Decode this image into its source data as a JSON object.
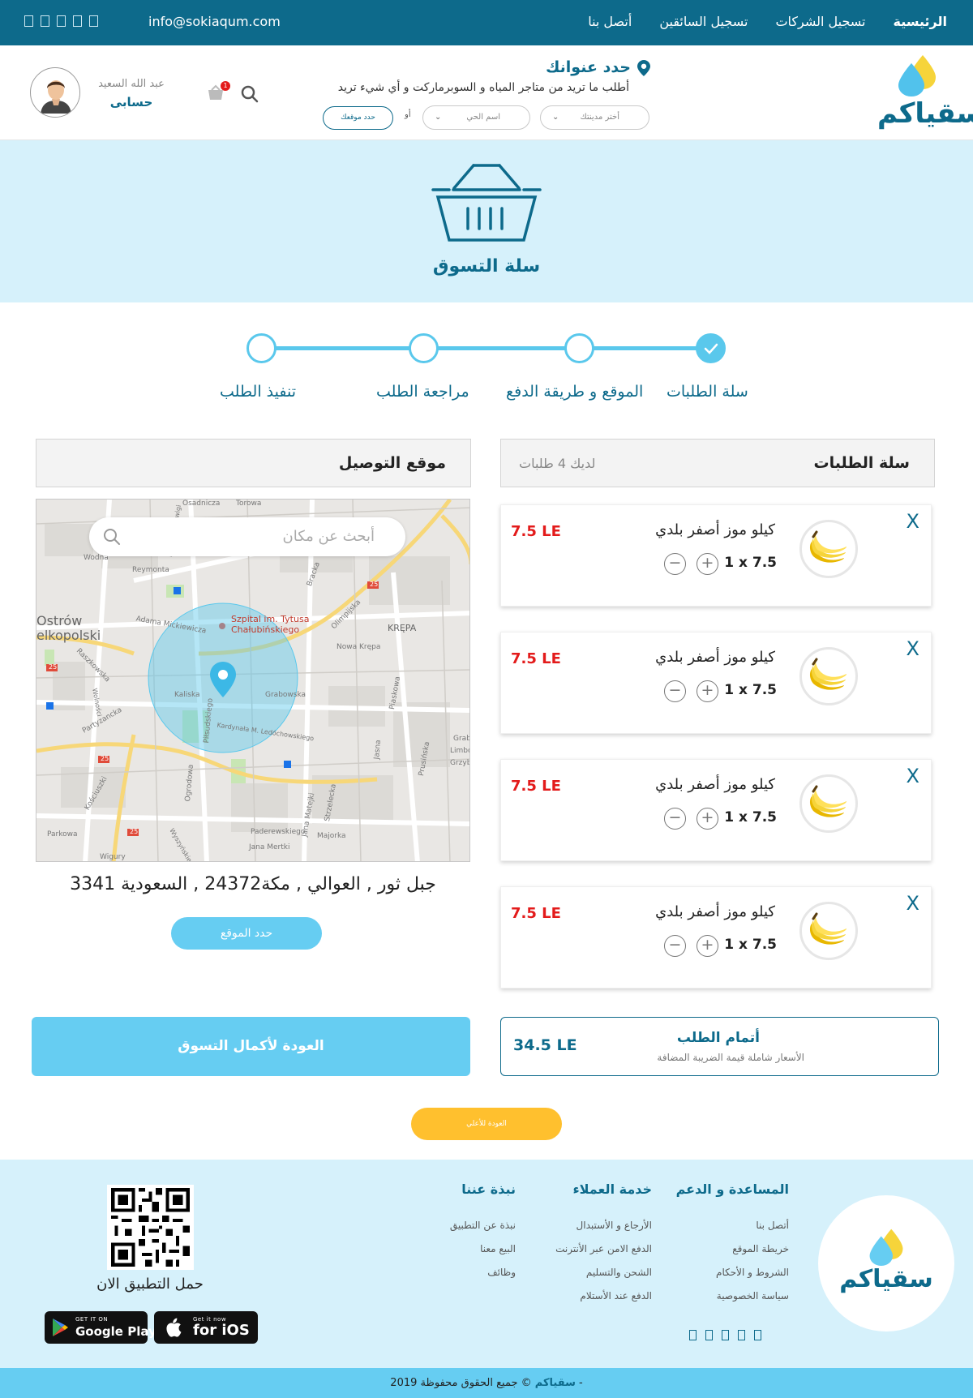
{
  "topbar": {
    "email": "info@sokiaqum.com",
    "nav": [
      "الرئيسية",
      "تسجيل الشركات",
      "تسجيل السائقين",
      "أتصل بنا"
    ],
    "social_icons": [
      "facebook-icon",
      "twitter-icon",
      "instagram-icon",
      "youtube-icon",
      "linkedin-icon"
    ]
  },
  "header": {
    "logo_text": "سقياكم",
    "address_title": "حدد عنوانك",
    "address_subtitle": "أطلب ما تريد من متاجر المياه و السوبرماركت و أي شيء تريد",
    "city_select": "أختر مدينتك",
    "district_select": "اسم الحي",
    "or_label": "أو",
    "locate_button": "حدد موقعك",
    "cart_badge": "1",
    "user_name": "عبد الله السعيد",
    "account_label": "حسابى"
  },
  "hero": {
    "title": "سلة التسوق"
  },
  "steps": [
    {
      "label": "سلة الطلبات",
      "done": true
    },
    {
      "label": "الموقع و طريقة الدفع",
      "done": false
    },
    {
      "label": "مراجعة الطلب",
      "done": false
    },
    {
      "label": "تنفيذ الطلب",
      "done": false
    }
  ],
  "cart": {
    "title": "سلة الطلبات",
    "count_text": "لديك 4 طلبات",
    "items": [
      {
        "name": "كيلو موز أصفر بلدي",
        "qty": "1 x 7.5",
        "price": "7.5 LE",
        "remove": "X"
      },
      {
        "name": "كيلو موز أصفر بلدي",
        "qty": "1 x 7.5",
        "price": "7.5 LE",
        "remove": "X"
      },
      {
        "name": "كيلو موز أصفر بلدي",
        "qty": "1 x 7.5",
        "price": "7.5 LE",
        "remove": "X"
      },
      {
        "name": "كيلو موز أصفر بلدي",
        "qty": "1 x 7.5",
        "price": "7.5 LE",
        "remove": "X"
      }
    ]
  },
  "delivery": {
    "title": "موقع التوصيل",
    "search_placeholder": "أبحث عن مكان",
    "address": "جبل ثور , العوالي , مكة24372 , السعودية 3341",
    "set_location_button": "حدد الموقع",
    "map_labels": {
      "osadnicza": "Osadnicza",
      "torowa": "Torowa",
      "wodna": "Wodna",
      "reymonta": "Reymonta",
      "krolowej_jadwigi": "Królowej Jadwigi",
      "ostrow": "Ostrów",
      "wielkopolski": "elkopolski",
      "adama": "Adama Mickiewicza",
      "szpital1": "Szpital im. Tytusa",
      "szpital2": "Chałubińskiego",
      "krepa": "KRĘPA",
      "olimpijska": "Olimpijska",
      "nowa_krepa": "Nowa Krępa",
      "raszkowska": "Raszkowska",
      "kaliska": "Kaliska",
      "grabowska": "Grabowska",
      "piaskowa": "Piaskowa",
      "partyzancka": "Partyzancka",
      "pilsudskiego": "Piłsudskiego",
      "kardynala": "Kardynała M. Ledóchowskiego",
      "jasna": "Jasna",
      "prusinska": "Prusińska",
      "kosciuszki": "Kościuszki",
      "matejki": "Jana Matejki",
      "strzelecka": "Strzelecka",
      "parkowa": "Parkowa",
      "wyszynskiego": "Wyszyńskiego",
      "paderewskiego": "Paderewskiego",
      "majorka": "Majorka",
      "mertki": "Jana Mertki",
      "wigury": "Wigury",
      "grab": "Grab",
      "limbo": "Limbo",
      "grzyb": "Grzyb",
      "wolnosci": "Wolności",
      "route25": "25",
      "bracka": "Bracka",
      "ogrodowa": "Ogrodowa"
    }
  },
  "summary": {
    "title": "أتمام الطلب",
    "subtitle": "الأسعار شاملة قيمة الضريبة المضافة",
    "total": "34.5 LE",
    "continue_button": "العودة لأكمال التسوق"
  },
  "back_to_top": "العودة للأعلي",
  "footer": {
    "logo_text": "سقياكم",
    "columns": [
      {
        "title": "المساعدة و الدعم",
        "items": [
          "أتصل بنا",
          "خريطة الموقع",
          "الشروط و الأحكام",
          "سياسة الخصوصية"
        ]
      },
      {
        "title": "خدمة العملاء",
        "items": [
          "الأرجاع و الأستبدال",
          "الدفع الامن عبر الأنترنت",
          "الشحن والتسليم",
          "الدفع عند الأستلام"
        ]
      },
      {
        "title": "نبذة عننا",
        "items": [
          "نبذة عن التطبيق",
          "البيع معنا",
          "وظائف"
        ]
      }
    ],
    "download_text": "حمل التطبيق الان",
    "google_play_small": "GET IT ON",
    "google_play_big": "Google Play",
    "ios_small": "Get it now",
    "ios_big": "for iOS",
    "copyright_prefix": "© جميع الحقوق محفوظة -",
    "copyright_brand": "سقياكم",
    "copyright_year": "2019"
  },
  "colors": {
    "primary": "#0d6a8b",
    "light_blue": "#66cdf2",
    "hero_bg": "#d6f1fb",
    "price_red": "#e31b1b",
    "yellow": "#ffc02e"
  }
}
